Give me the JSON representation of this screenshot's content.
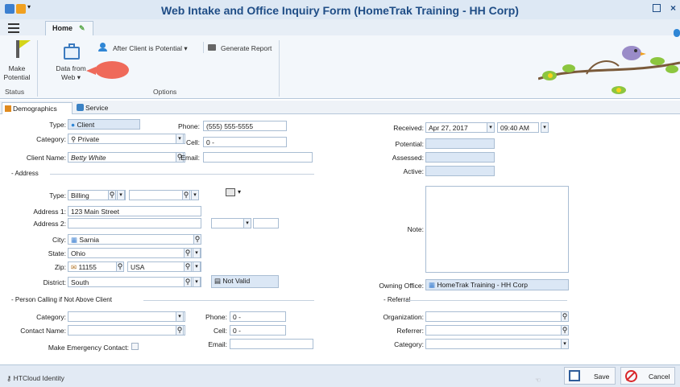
{
  "window": {
    "title": "Web Intake and Office Inquiry Form (HomeTrak Training - HH Corp)"
  },
  "ribbon": {
    "tab": "Home",
    "make_potential": [
      "Make",
      "Potential"
    ],
    "data_from": [
      "Data from",
      "Web"
    ],
    "after_client": "After Client is Potential",
    "generate_report": "Generate Report",
    "group_status": "Status",
    "group_options": "Options"
  },
  "tabs": {
    "demographics": "Demographics",
    "service": "Service"
  },
  "form": {
    "type_label": "Type:",
    "type_value": "Client",
    "category_label": "Category:",
    "category_value": "Private",
    "client_name_label": "Client Name:",
    "client_name_value": "Betty White",
    "phone_label": "Phone:",
    "phone_value": "(555) 555-5555",
    "cell_label": "Cell:",
    "cell_value": "0 -",
    "email_label": "Email:",
    "email_value": "",
    "address_group": "Address",
    "addr_type_label": "Type:",
    "addr_type_value": "Billing",
    "address1_label": "Address 1:",
    "address1_value": "123 Main Street",
    "address2_label": "Address 2:",
    "address2_value": "",
    "city_label": "City:",
    "city_value": "Sarnia",
    "state_label": "State:",
    "state_value": "Ohio",
    "zip_label": "Zip:",
    "zip_value": "11155",
    "country_value": "USA",
    "district_label": "District:",
    "district_value": "South",
    "not_valid": "Not Valid",
    "received_label": "Received:",
    "received_date": "Apr 27, 2017",
    "received_time": "09:40 AM",
    "potential_label": "Potential:",
    "assessed_label": "Assessed:",
    "active_label": "Active:",
    "note_label": "Note:",
    "owning_office_label": "Owning Office:",
    "owning_office_value": "HomeTrak Training - HH Corp",
    "person_group": "Person Calling if Not Above Client",
    "pc_category_label": "Category:",
    "pc_contact_label": "Contact Name:",
    "pc_emergency_label": "Make Emergency Contact:",
    "pc_phone_label": "Phone:",
    "pc_phone_value": "0 -",
    "pc_cell_label": "Cell:",
    "pc_cell_value": "0 -",
    "pc_email_label": "Email:",
    "referral_group": "Referral",
    "organization_label": "Organization:",
    "referrer_label": "Referrer:",
    "ref_category_label": "Category:"
  },
  "status": {
    "identity": "HTCloud Identity",
    "save": "Save",
    "cancel": "Cancel"
  },
  "colors": {
    "title": "#1f4d86",
    "cancel_red": "#d9262a",
    "callout": "#ef6a5a"
  }
}
